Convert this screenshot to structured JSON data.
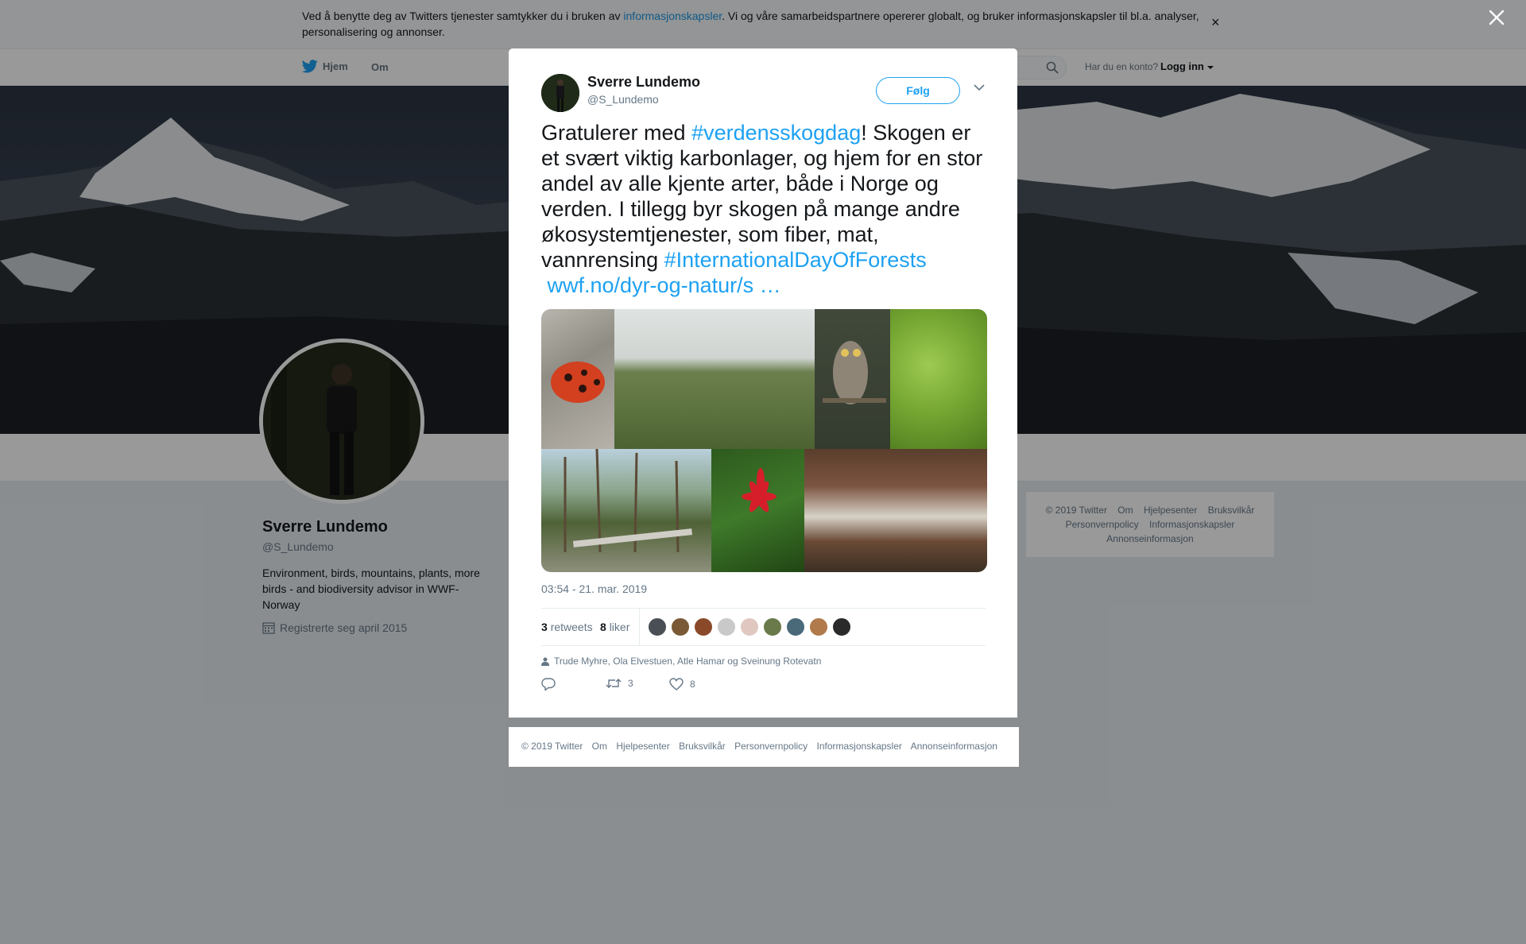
{
  "cookie_banner": {
    "text_before": "Ved å benytte deg av Twitters tjenester samtykker du i bruken av ",
    "link": "informasjonskapsler",
    "text_after": ". Vi og våre samarbeidspartnere opererer globalt, og bruker informasjonskapsler til bl.a. analyser, personalisering og annonser.",
    "close": "×"
  },
  "nav": {
    "home": "Hjem",
    "about": "Om",
    "account_prompt": "Har du en konto?",
    "login": "Logg inn"
  },
  "profile": {
    "name": "Sverre Lundemo",
    "handle": "@S_Lundemo",
    "bio": "Environment, birds, mountains, plants, more birds - and biodiversity advisor in WWF-Norway",
    "joined": "Registrerte seg april 2015"
  },
  "side_footer": {
    "links": [
      "© 2019 Twitter",
      "Om",
      "Hjelpesenter",
      "Bruksvilkår",
      "Personvernpolicy",
      "Informasjonskapsler",
      "Annonseinformasjon"
    ]
  },
  "tweet": {
    "author_name": "Sverre Lundemo",
    "author_handle": "@S_Lundemo",
    "follow_label": "Følg",
    "text_1": "Gratulerer med ",
    "hashtag_1": "#verdensskogdag",
    "text_2": "! Skogen er et svært viktig karbonlager, og hjem for en stor andel av alle kjente arter, både i Norge og verden. I tillegg byr skogen på mange andre økosystemtjenester, som fiber, mat, vannrensing ",
    "hashtag_2": "#InternationalDayOfForests",
    "url": "wwf.no/dyr-og-natur/s …",
    "timestamp": "03:54 - 21. mar. 2019",
    "retweets_count": "3",
    "retweets_label": "retweets",
    "likes_count": "8",
    "likes_label": "liker",
    "replying_to": "Trude Myhre, Ola Elvestuen, Atle Hamar og Sveinung Rotevatn",
    "action_retweet_count": "3",
    "action_like_count": "8"
  },
  "modal_footer": {
    "links": [
      "© 2019 Twitter",
      "Om",
      "Hjelpesenter",
      "Bruksvilkår",
      "Personvernpolicy",
      "Informasjonskapsler",
      "Annonseinformasjon"
    ]
  },
  "colors": {
    "accent": "#1da1f2",
    "link": "#1b95e0",
    "muted": "#657786"
  }
}
